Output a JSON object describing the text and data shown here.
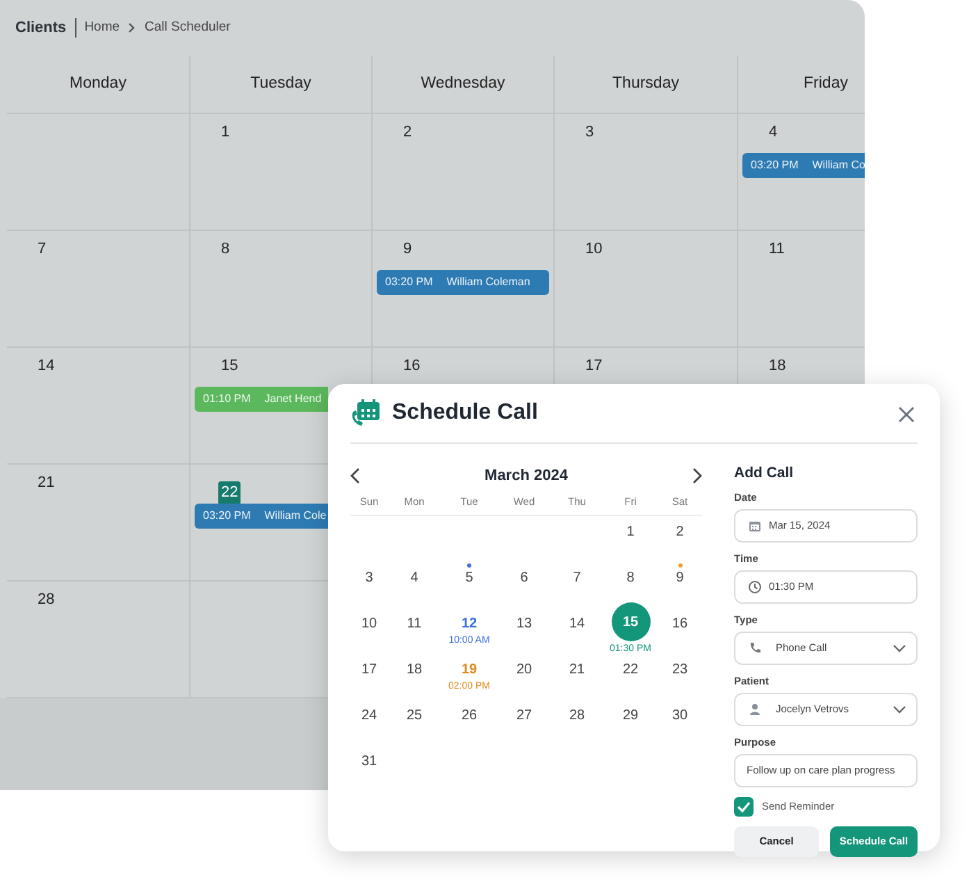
{
  "breadcrumb": {
    "title": "Clients",
    "items": [
      {
        "label": "Home"
      },
      {
        "label": "Call Scheduler"
      }
    ]
  },
  "calendar": {
    "weekdays": [
      "Monday",
      "Tuesday",
      "Wednesday",
      "Thursday",
      "Friday"
    ],
    "weeks": [
      {
        "days": [
          {
            "label": "1",
            "today": false
          },
          {
            "label": "2",
            "today": false
          },
          {
            "label": "3",
            "today": false
          },
          {
            "label": "4",
            "today": false,
            "events": [
              {
                "time": "03:20 PM",
                "name": "William Co",
                "color": "#2e7bb4"
              }
            ]
          }
        ]
      },
      {
        "days": [
          {
            "label": "7",
            "today": false
          },
          {
            "label": "8",
            "today": false
          },
          {
            "label": "9",
            "today": false,
            "events": [
              {
                "time": "03:20 PM",
                "name": "William Coleman",
                "color": "#2e7bb4"
              }
            ]
          },
          {
            "label": "10",
            "today": false
          },
          {
            "label": "11",
            "today": false
          }
        ]
      },
      {
        "days": [
          {
            "label": "14",
            "today": false
          },
          {
            "label": "15",
            "today": false,
            "events": [
              {
                "time": "01:10 PM",
                "name": "Janet Hend",
                "color": "#5cb85c"
              }
            ]
          },
          {
            "label": "16",
            "today": false
          },
          {
            "label": "17",
            "today": false
          },
          {
            "label": "18",
            "today": false
          }
        ]
      },
      {
        "days": [
          {
            "label": "21",
            "today": false
          },
          {
            "label": "22",
            "today": true,
            "events": [
              {
                "time": "03:20 PM",
                "name": "William Cole",
                "color": "#2e7bb4"
              }
            ]
          }
        ]
      },
      {
        "days": [
          {
            "label": "28",
            "today": false
          }
        ]
      }
    ]
  },
  "dialog": {
    "title": "Schedule Call",
    "mini_calendar": {
      "month": "March 2024",
      "weekdays": [
        "Sun",
        "Mon",
        "Tue",
        "Wed",
        "Thu",
        "Fri",
        "Sat"
      ],
      "weeks": [
        {
          "days": [
            {
              "label": "1",
              "selected": false
            },
            {
              "label": "2",
              "selected": false
            }
          ]
        },
        {
          "days": [
            {
              "label": "3",
              "selected": false
            },
            {
              "label": "4",
              "selected": false
            },
            {
              "label": "5",
              "selected": false,
              "marker": {
                "color": "#3b6fe0"
              }
            },
            {
              "label": "6",
              "selected": false
            },
            {
              "label": "7",
              "selected": false
            },
            {
              "label": "8",
              "selected": false
            },
            {
              "label": "9",
              "selected": false,
              "marker": {
                "color": "#f0a030"
              }
            }
          ]
        },
        {
          "days": [
            {
              "label": "10",
              "selected": false
            },
            {
              "label": "11",
              "selected": false
            },
            {
              "label": "12",
              "selected": false,
              "event": {
                "time": "10:00 AM",
                "color": "#3b6fe0"
              }
            },
            {
              "label": "13",
              "selected": false
            },
            {
              "label": "14",
              "selected": false
            },
            {
              "label": "15",
              "selected": true,
              "event": {
                "time": "01:30 PM",
                "color": "#14967a"
              }
            },
            {
              "label": "16",
              "selected": false
            }
          ]
        },
        {
          "days": [
            {
              "label": "17",
              "selected": false
            },
            {
              "label": "18",
              "selected": false
            },
            {
              "label": "19",
              "selected": false,
              "event": {
                "time": "02:00 PM",
                "color": "#e08a1e"
              }
            },
            {
              "label": "20",
              "selected": false
            },
            {
              "label": "21",
              "selected": false
            },
            {
              "label": "22",
              "selected": false
            },
            {
              "label": "23",
              "selected": false
            }
          ]
        },
        {
          "days": [
            {
              "label": "24",
              "selected": false
            },
            {
              "label": "25",
              "selected": false
            },
            {
              "label": "26",
              "selected": false
            },
            {
              "label": "27",
              "selected": false
            },
            {
              "label": "28",
              "selected": false
            },
            {
              "label": "29",
              "selected": false
            },
            {
              "label": "30",
              "selected": false
            }
          ]
        },
        {
          "days": [
            {
              "label": "31",
              "selected": false
            }
          ]
        }
      ]
    },
    "form": {
      "title": "Add Call",
      "fields": [
        {
          "label": "Date",
          "value": "Mar 15, 2024",
          "kind": "text"
        },
        {
          "label": "Time",
          "value": "01:30 PM",
          "kind": "text"
        },
        {
          "label": "Type",
          "value": "Phone Call",
          "kind": "select"
        },
        {
          "label": "Patient",
          "value": "Jocelyn Vetrovs",
          "kind": "select"
        },
        {
          "label": "Purpose",
          "value": "Follow up on care plan progress",
          "kind": "text"
        }
      ],
      "reminder": {
        "label": "Send Reminder",
        "checked": true
      },
      "buttons": [
        {
          "label": "Cancel",
          "kind": "secondary"
        },
        {
          "label": "Schedule Call",
          "kind": "primary"
        }
      ]
    }
  }
}
